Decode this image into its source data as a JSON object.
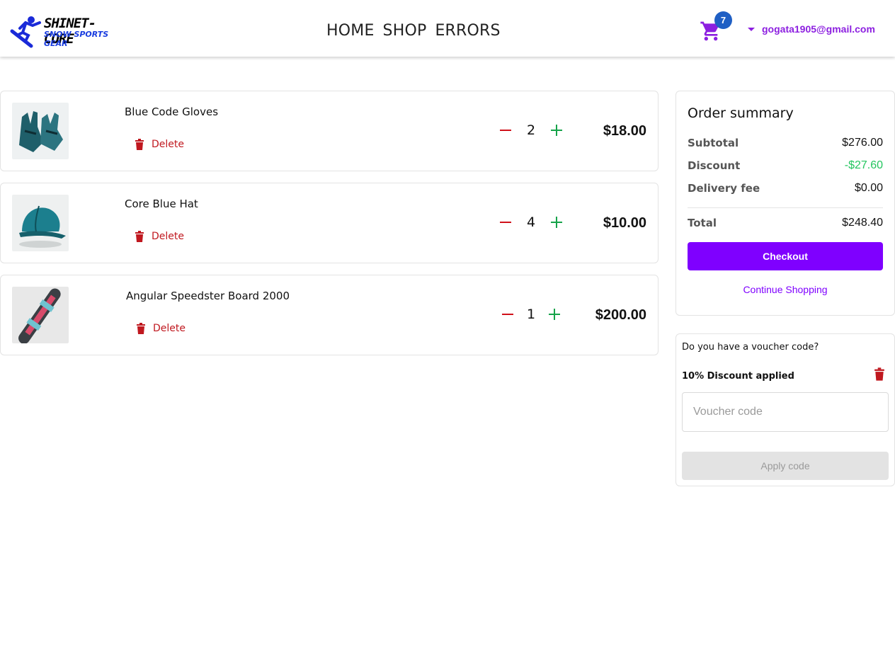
{
  "header": {
    "logo_line1": "SHINET-CORE",
    "logo_line2": "SNOW SPORTS GEAR",
    "nav": [
      "HOME",
      "SHOP",
      "ERRORS"
    ],
    "cart_count": "7",
    "user_email": "gogata1905@gmail.com"
  },
  "cart_items": [
    {
      "name": "Blue Code Gloves",
      "quantity": "2",
      "price": "$18.00",
      "delete_label": "Delete",
      "image_icon": "gloves-image"
    },
    {
      "name": "Core Blue Hat",
      "quantity": "4",
      "price": "$10.00",
      "delete_label": "Delete",
      "image_icon": "hat-image"
    },
    {
      "name": "Angular Speedster Board 2000",
      "quantity": "1",
      "price": "$200.00",
      "delete_label": "Delete",
      "image_icon": "snowboard-image"
    }
  ],
  "summary": {
    "title": "Order summary",
    "subtotal_label": "Subtotal",
    "subtotal_value": "$276.00",
    "discount_label": "Discount",
    "discount_value": "-$27.60",
    "delivery_label": "Delivery fee",
    "delivery_value": "$0.00",
    "total_label": "Total",
    "total_value": "$248.40",
    "checkout_label": "Checkout",
    "continue_label": "Continue Shopping"
  },
  "voucher": {
    "question": "Do you have a voucher code?",
    "applied_text": "10% Discount applied",
    "input_placeholder": "Voucher code",
    "input_value": "",
    "apply_label": "Apply code"
  },
  "colors": {
    "accent": "#7f00ff",
    "delete_red": "#c0181f",
    "plus_green": "#16a34a",
    "discount_green": "#22c55e",
    "badge_blue": "#1f5fc4"
  }
}
